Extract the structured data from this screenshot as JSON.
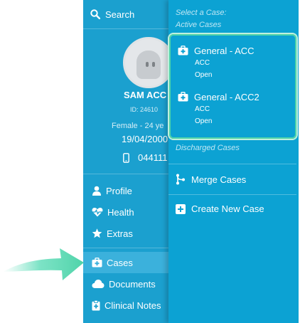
{
  "sidebar": {
    "search_label": "Search",
    "patient": {
      "name": "SAM ACC",
      "id": "ID: 24610",
      "info": "Female - 24 ye",
      "dob": "19/04/2000",
      "phone": "044111"
    },
    "nav": [
      {
        "label": "Profile",
        "icon": "person-icon"
      },
      {
        "label": "Health",
        "icon": "heartbeat-icon"
      },
      {
        "label": "Extras",
        "icon": "star-icon"
      },
      {
        "label": "Cases",
        "icon": "medical-case-icon",
        "active": true
      },
      {
        "label": "Documents",
        "icon": "cloud-icon"
      },
      {
        "label": "Clinical Notes",
        "icon": "clipboard-plus-icon"
      }
    ]
  },
  "cases_menu": {
    "header": "Select a Case:",
    "active_heading": "Active Cases",
    "active_cases": [
      {
        "title": "General - ACC",
        "type": "ACC",
        "status": "Open"
      },
      {
        "title": "General - ACC2",
        "type": "ACC",
        "status": "Open"
      }
    ],
    "discharged_heading": "Discharged Cases",
    "merge_label": "Merge Cases",
    "create_label": "Create New Case"
  },
  "colors": {
    "sidebar": "#1ba0cf",
    "panel": "#0ca2d3",
    "highlight": "#4fd3a9"
  }
}
